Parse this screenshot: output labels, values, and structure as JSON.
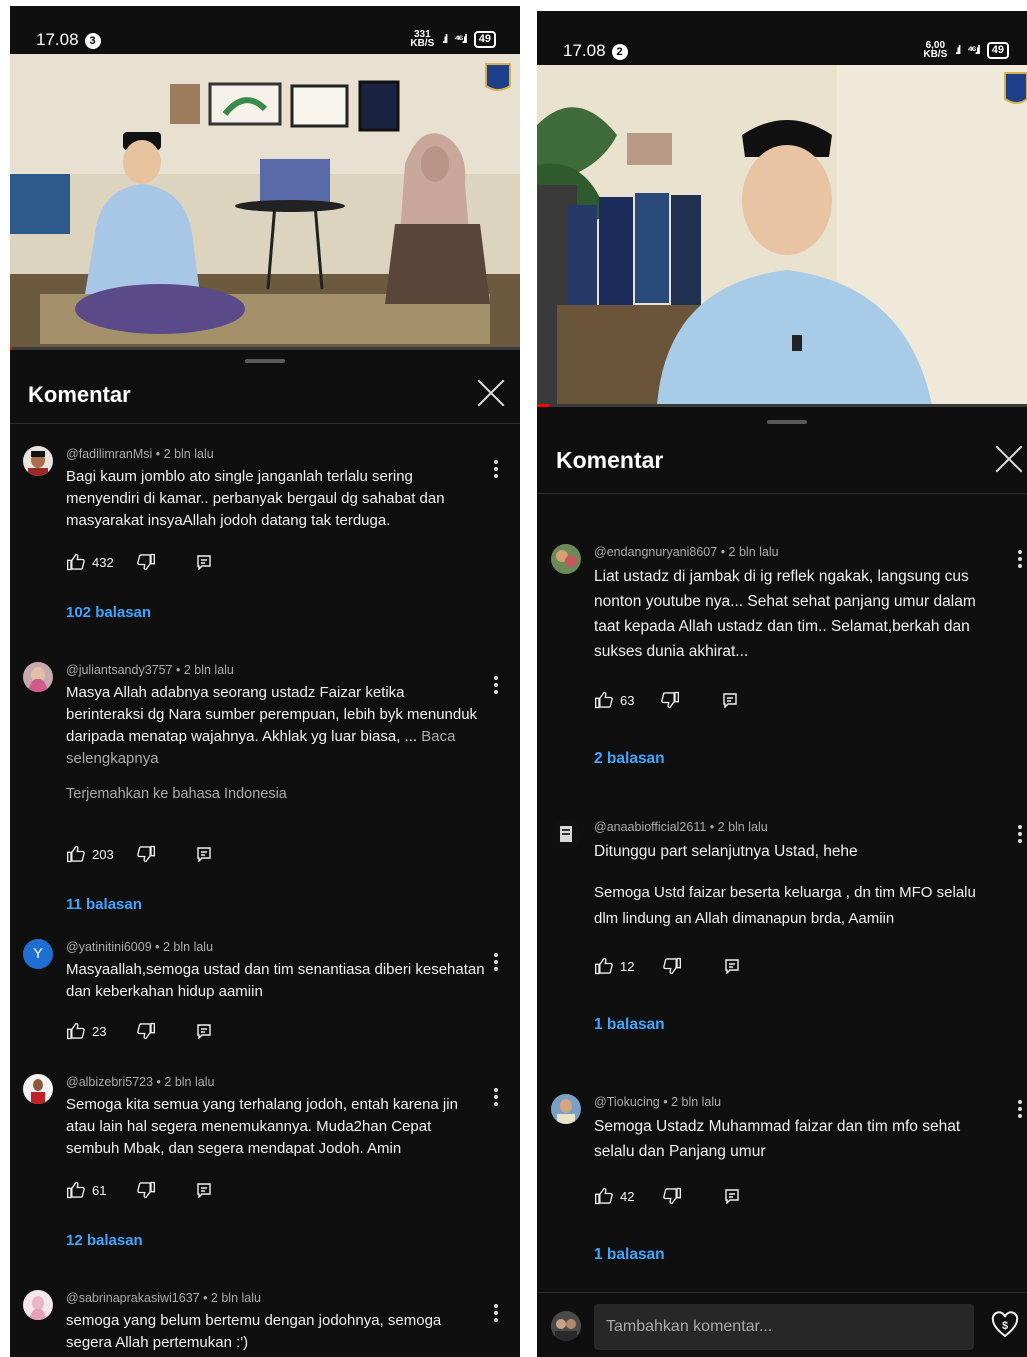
{
  "screens": [
    {
      "status": {
        "time": "17.08",
        "badge": "3",
        "net_speed": "331",
        "net_unit": "KB/S",
        "signal": "⁴⁶",
        "battery": "49"
      },
      "panel": {
        "title": "Komentar"
      },
      "comments": [
        {
          "author": "@fadilimranMsi",
          "age": "2 bln lalu",
          "text": "Bagi kaum jomblo ato single janganlah terlalu sering menyendiri di kamar.. perbanyak bergaul dg sahabat dan masyarakat insyaAllah jodoh datang tak terduga.",
          "likes": "432",
          "replies": "102 balasan"
        },
        {
          "author": "@juliantsandy3757",
          "age": "2 bln lalu",
          "text": "Masya Allah adabnya seorang ustadz Faizar ketika berinteraksi dg Nara sumber perempuan, lebih byk menunduk daripada menatap wajahnya. Akhlak yg luar biasa, ...",
          "more": "Baca selengkapnya",
          "translate": "Terjemahkan ke bahasa Indonesia",
          "likes": "203",
          "replies": "11 balasan"
        },
        {
          "author": "@yatinitini6009",
          "age": "2 bln lalu",
          "text": "Masyaallah,semoga ustad dan tim senantiasa diberi kesehatan dan keberkahan hidup aamiin",
          "likes": "23",
          "avatar_letter": "Y"
        },
        {
          "author": "@albizebri5723",
          "age": "2 bln lalu",
          "text": "Semoga kita semua yang terhalang jodoh, entah karena jin atau lain hal segera menemukannya. Muda2han Cepat sembuh Mbak, dan segera mendapat Jodoh. Amin",
          "likes": "61",
          "replies": "12 balasan"
        },
        {
          "author": "@sabrinaprakasiwi1637",
          "age": "2 bln lalu",
          "text": "semoga yang belum bertemu dengan jodohnya, semoga segera Allah pertemukan :')"
        }
      ]
    },
    {
      "status": {
        "time": "17.08",
        "badge": "2",
        "net_speed": "6,00",
        "net_unit": "KB/S",
        "signal": "⁴⁶",
        "battery": "49"
      },
      "panel": {
        "title": "Komentar"
      },
      "comments": [
        {
          "author": "@endangnuryani8607",
          "age": "2 bln lalu",
          "text": "Liat ustadz di jambak di ig reflek ngakak, langsung cus nonton youtube nya... Sehat sehat panjang umur dalam taat kepada Allah ustadz dan tim.. Selamat,berkah dan sukses dunia akhirat...",
          "likes": "63",
          "replies": "2 balasan"
        },
        {
          "author": "@anaabiofficial2611",
          "age": "2 bln lalu",
          "text": "Ditunggu part selanjutnya Ustad, hehe",
          "text2": "Semoga Ustd faizar beserta keluarga , dn tim MFO selalu dlm lindung an Allah dimanapun brda, Aamiin",
          "likes": "12",
          "replies": "1 balasan"
        },
        {
          "author": "@Tiokucing",
          "age": "2 bln lalu",
          "text": "Semoga Ustadz Muhammad faizar dan tim mfo sehat selalu dan Panjang umur",
          "likes": "42",
          "replies": "1 balasan"
        }
      ],
      "input": {
        "placeholder": "Tambahkan komentar..."
      }
    }
  ],
  "colors": {
    "background": "#0f0f0f",
    "link": "#3ea6ff",
    "meta": "#aaaaaa",
    "progress": "#ff0000"
  },
  "icons": [
    "like-icon",
    "dislike-icon",
    "reply-icon",
    "more-vert-icon",
    "close-icon",
    "thanks-icon",
    "channel-logo-icon"
  ]
}
